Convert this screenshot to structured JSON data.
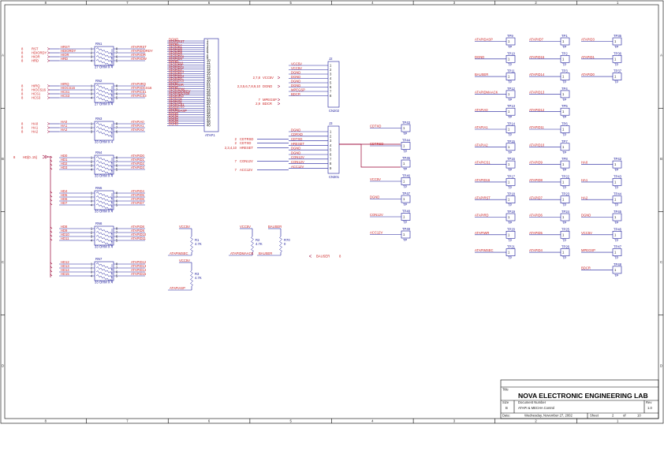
{
  "border": {
    "cols": [
      "8",
      "7",
      "6",
      "5",
      "4",
      "3",
      "2",
      "1"
    ],
    "rows": [
      "A",
      "B",
      "C",
      "D"
    ]
  },
  "title_block": {
    "company": "NOVA ELECTRONIC ENGINEERING LAB",
    "title_label": "Title",
    "size_label": "Size",
    "size": "B",
    "docnum_label": "Document Number",
    "docnum": "ATAPI & MECHA Control",
    "rev_label": "Rev",
    "rev": "1.0",
    "date_label": "Date:",
    "date": "Wednesday, November 27, 2002",
    "sheet_label": "Sheet",
    "sheet": "2",
    "of_label": "of",
    "sheets": "10"
  },
  "rnets": [
    {
      "ref": "RN1",
      "value": "27 OHM X 4",
      "left": [
        {
          "pin": "8",
          "net": "RST"
        },
        {
          "pin": "8",
          "net": "HDIORDY"
        },
        {
          "pin": "8",
          "net": "HIOR"
        },
        {
          "pin": "8",
          "net": "HRD"
        }
      ],
      "in": [
        "HRST",
        "HDIORDY",
        "HIOR",
        "HRD"
      ],
      "out": [
        "ATAPIRST",
        "ATAPIDIORDY",
        "ATAPIIOR",
        "ATAPIIOW"
      ]
    },
    {
      "ref": "RN2",
      "value": "27 OHM X 4",
      "left": [
        {
          "pin": "8",
          "net": "HIRQ"
        },
        {
          "pin": "8",
          "net": "HIOCS16"
        },
        {
          "pin": "8",
          "net": "HCS1"
        },
        {
          "pin": "8",
          "net": "HCS3"
        }
      ],
      "in": [
        "HIRQ",
        "HIOCS16",
        "HCS1",
        "HCS3"
      ],
      "out": [
        "ATAPIIRQ",
        "ATAPIIOCS16",
        "ATAPICS1",
        "ATAPICS3"
      ]
    },
    {
      "ref": "RN3",
      "value": "33 OHM X 4",
      "left": [
        {
          "pin": "8",
          "net": "HA0"
        },
        {
          "pin": "8",
          "net": "HA1"
        },
        {
          "pin": "8",
          "net": "HA2"
        }
      ],
      "in": [
        "HA0",
        "HA1",
        "HA2",
        ""
      ],
      "out": [
        "ATAPIA0",
        "ATAPIA1",
        "ATAPIA2",
        ""
      ]
    },
    {
      "ref": "RN4",
      "value": "33 OHM X 4",
      "left": [],
      "in": [
        "HD0",
        "HD1",
        "HD2",
        "HD3"
      ],
      "out": [
        "ATAPID0",
        "ATAPID1",
        "ATAPID2",
        "ATAPID3"
      ]
    },
    {
      "ref": "RN5",
      "value": "33 OHM X 4",
      "left": [],
      "in": [
        "HD4",
        "HD5",
        "HD6",
        "HD7"
      ],
      "out": [
        "ATAPID4",
        "ATAPID5",
        "ATAPID6",
        "ATAPID7"
      ]
    },
    {
      "ref": "RN6",
      "value": "33 OHM X 4",
      "left": [],
      "in": [
        "HD8",
        "HD9",
        "HD10",
        "HD11"
      ],
      "out": [
        "ATAPID8",
        "ATAPID9",
        "ATAPID10",
        "ATAPID11"
      ]
    },
    {
      "ref": "RN7",
      "value": "33 OHM X 4",
      "left": [],
      "in": [
        "HD12",
        "HD13",
        "HD14",
        "HD15"
      ],
      "out": [
        "ATAPID12",
        "ATAPID13",
        "ATAPID14",
        "ATAPID15"
      ]
    }
  ],
  "hdbus": {
    "pin": "8",
    "label": "HD[0..15]"
  },
  "j1": {
    "ref": "ATAP1",
    "nets": [
      "DGND",
      "ATAPIRST",
      "DGND",
      "ATAPID7",
      "ATAPID8",
      "ATAPID6",
      "ATAPID9",
      "ATAPID5",
      "ATAPID10",
      "ATAPID4",
      "DGND",
      "ATAPID11",
      "ATAPID3",
      "ATAPID12",
      "ATAPID2",
      "ATAPID13",
      "ATAPID1",
      "ATAPID14",
      "ATAPID0",
      "ATAPID15",
      "DGND",
      "ATAPIIOR",
      "DGND",
      "ATAPIIOW",
      "ATAPIDIORDY",
      "ATAPIIOCS16",
      "ATAPIIRQ",
      "ATAPIA1",
      "ATAPIA0",
      "ATAPIA2",
      "ATAPICS1",
      "ATAPICS3",
      "DGND",
      "ATAPIDASP",
      "DGND",
      "DGND",
      "DGND",
      "DGND",
      "DGND",
      "DGND"
    ]
  },
  "cn202": {
    "ref": "CN202",
    "left": [
      {
        "pins": "2,7,8",
        "net": "VCC5V"
      },
      {
        "pins": "2,3,5,6,7,8,9,10",
        "net": "DGND"
      },
      {
        "pins": "7",
        "net": "MPEGSP"
      },
      {
        "pins": "2,9",
        "net": "BDCR"
      }
    ],
    "nets": [
      "VCC5V",
      "VCC5V",
      "DGND",
      "DGND",
      "DGND",
      "DGND",
      "MPEGSP",
      "BDCR"
    ]
  },
  "cn301": {
    "ref": "CN301",
    "left": [
      {
        "pins": "2",
        "net": "CDTRSD"
      },
      {
        "pins": "2",
        "net": "CDTXD"
      },
      {
        "pins": "2,3,4,10",
        "net": "HRESET"
      },
      {
        "pins": "7",
        "net": "CON12V"
      },
      {
        "pins": "7",
        "net": "ACC12V"
      }
    ],
    "nets": [
      "DGND",
      "CDRXD",
      "CDTXD",
      "HRESET",
      "DGND",
      "DGND",
      "CON12V",
      "CON12V",
      "ACC12V"
    ]
  },
  "resistors": [
    {
      "ref": "R1",
      "value": "4.7K",
      "top": "VCC5V",
      "bottom": "ATAPIMSEC"
    },
    {
      "ref": "R2",
      "value": "4.7K",
      "top": "VCC5V",
      "bottom": "ATAPIDMAACK"
    },
    {
      "ref": "R3",
      "value": "4.7K",
      "top": "VCC5V",
      "bottom": "ATAPIASP"
    },
    {
      "ref": "R70",
      "value": "0",
      "top": "BAUSER",
      "bottom": "BAUSER"
    }
  ],
  "r70_right": {
    "net": "BAUSER",
    "pin": "8"
  },
  "mid_tps": [
    {
      "ref": "TP43",
      "net": "CDTXD"
    },
    {
      "ref": "TP44",
      "net": "CDTRSD"
    },
    {
      "ref": "TP45",
      "net": ""
    },
    {
      "ref": "TP46",
      "net": "VCC5V"
    },
    {
      "ref": "TP47",
      "net": "DGND"
    },
    {
      "ref": "TP48",
      "net": "CON12V"
    },
    {
      "ref": "TP49",
      "net": "ACC12V"
    }
  ],
  "tp_cols": [
    [
      {
        "ref": "TP9",
        "net": "ATAPIDASP"
      },
      {
        "ref": "TP10",
        "net": "DGND"
      },
      {
        "ref": "TP11",
        "net": "BAUSER"
      },
      {
        "ref": "TP12",
        "net": "ATAPIDMAACK"
      },
      {
        "ref": "TP13",
        "net": "ATAPIA0"
      },
      {
        "ref": "TP14",
        "net": "ATAPIA1"
      },
      {
        "ref": "TP15",
        "net": "ATAPIA2"
      },
      {
        "ref": "TP16",
        "net": "ATAPICS1"
      },
      {
        "ref": "TP17",
        "net": "ATAPID16"
      },
      {
        "ref": "TP18",
        "net": "ATAPIRST"
      },
      {
        "ref": "TP19",
        "net": "ATAPIRD"
      },
      {
        "ref": "TP20",
        "net": "ATAPIWR"
      },
      {
        "ref": "TP21",
        "net": "ATAPIMSEC"
      }
    ],
    [
      {
        "ref": "TP1",
        "net": "ATAPIID7"
      },
      {
        "ref": "TP2",
        "net": "ATAPID15"
      },
      {
        "ref": "TP3",
        "net": "ATAPID14"
      },
      {
        "ref": "TP4",
        "net": "ATAPID13"
      },
      {
        "ref": "TP5",
        "net": "ATAPID12"
      },
      {
        "ref": "TP6",
        "net": "ATAPID11"
      },
      {
        "ref": "TP7",
        "net": "ATAPID10"
      },
      {
        "ref": "TP8",
        "net": "ATAPID9"
      },
      {
        "ref": "TP22",
        "net": "ATAPID8"
      },
      {
        "ref": "TP23",
        "net": "ATAPID7"
      },
      {
        "ref": "TP24",
        "net": "ATAPID6"
      },
      {
        "ref": "TP25",
        "net": "ATAPID5"
      },
      {
        "ref": "TP26",
        "net": "ATAPID4"
      }
    ],
    [
      {
        "ref": "TP35",
        "net": "ATAPID3"
      },
      {
        "ref": "TP36",
        "net": "ATAPID1"
      },
      {
        "ref": "TP37",
        "net": "ATAPID0"
      },
      {
        "ref": "TP38",
        "net": ""
      },
      {
        "ref": "TP39",
        "net": ""
      },
      {
        "ref": "TP40",
        "net": ""
      },
      {
        "ref": "TP41",
        "net": ""
      },
      {
        "ref": "TP42",
        "net": "HA0"
      },
      {
        "ref": "TP43",
        "net": "HA1"
      },
      {
        "ref": "TP44",
        "net": "HA2"
      },
      {
        "ref": "TP45",
        "net": "DGND"
      },
      {
        "ref": "TP46",
        "net": "VCC5V"
      },
      {
        "ref": "TP47",
        "net": "MPEGSP"
      },
      {
        "ref": "TP48",
        "net": "BDCR"
      }
    ]
  ],
  "tp_label": "TP",
  "colors": {
    "net": "#cc2222",
    "part": "#1a1a9a",
    "bus": "#990033"
  }
}
